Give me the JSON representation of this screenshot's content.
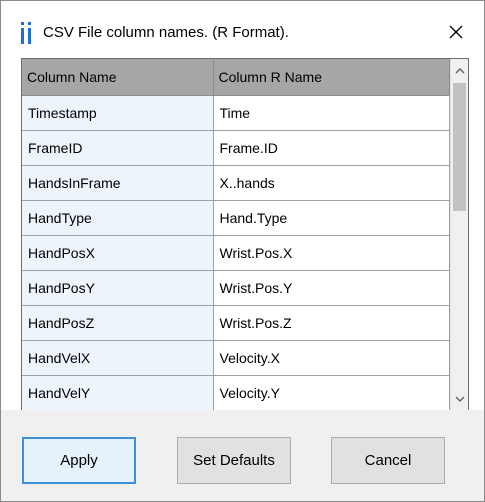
{
  "window": {
    "title": "CSV File column names. (R Format).",
    "close_icon": "close-icon",
    "app_icon": "info-i-icon"
  },
  "grid": {
    "columns": [
      "Column Name",
      "Column R Name"
    ],
    "rows": [
      [
        "Timestamp",
        "Time"
      ],
      [
        "FrameID",
        "Frame.ID"
      ],
      [
        "HandsInFrame",
        "X..hands"
      ],
      [
        "HandType",
        "Hand.Type"
      ],
      [
        "HandPosX",
        "Wrist.Pos.X"
      ],
      [
        "HandPosY",
        "Wrist.Pos.Y"
      ],
      [
        "HandPosZ",
        "Wrist.Pos.Z"
      ],
      [
        "HandVelX",
        "Velocity.X"
      ],
      [
        "HandVelY",
        "Velocity.Y"
      ]
    ]
  },
  "buttons": {
    "apply": "Apply",
    "set_defaults": "Set Defaults",
    "cancel": "Cancel"
  },
  "colors": {
    "header_bg": "#a6a6a6",
    "name_cell_bg": "#eef4fb",
    "accent": "#3c8fd8",
    "footer_bg": "#f0f0f0"
  }
}
